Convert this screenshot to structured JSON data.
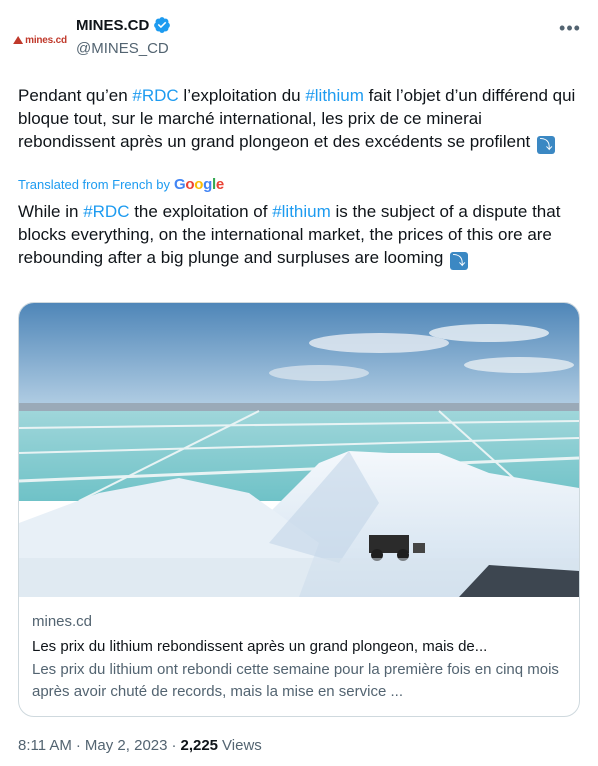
{
  "author": {
    "name": "MINES.CD",
    "handle": "@MINES_CD",
    "avatar_text": "mines.cd"
  },
  "tweet": {
    "original_parts": [
      "Pendant qu’en ",
      "#RDC",
      " l’exploitation du ",
      "#lithium",
      " fait l’objet d’un différend qui bloque tout, sur le marché international, les prix de ce minerai rebondissent après un grand plongeon et des excédents se profilent "
    ],
    "translated_label": "Translated from French by",
    "google_letters": [
      "G",
      "o",
      "o",
      "g",
      "l",
      "e"
    ],
    "translation_parts": [
      "While in ",
      "#RDC",
      " the exploitation of ",
      "#lithium",
      " is the subject of a dispute that blocks everything, on the international market, the prices of this ore are rebounding after a big plunge and surpluses are looming "
    ],
    "emoji": "⤵"
  },
  "card": {
    "domain": "mines.cd",
    "title": "Les prix du lithium rebondissent après un grand plongeon, mais de...",
    "description": "Les prix du lithium ont rebondi cette semaine pour la première fois en cinq mois après avoir chuté de records, mais la mise en service ..."
  },
  "meta": {
    "time": "8:11 AM",
    "separator": "·",
    "date": "May 2, 2023",
    "views_count": "2,225",
    "views_label": "Views"
  },
  "colors": {
    "accent": "#1d9bf0",
    "text": "#0f1419",
    "secondary": "#536471",
    "border": "#cfd9de"
  }
}
